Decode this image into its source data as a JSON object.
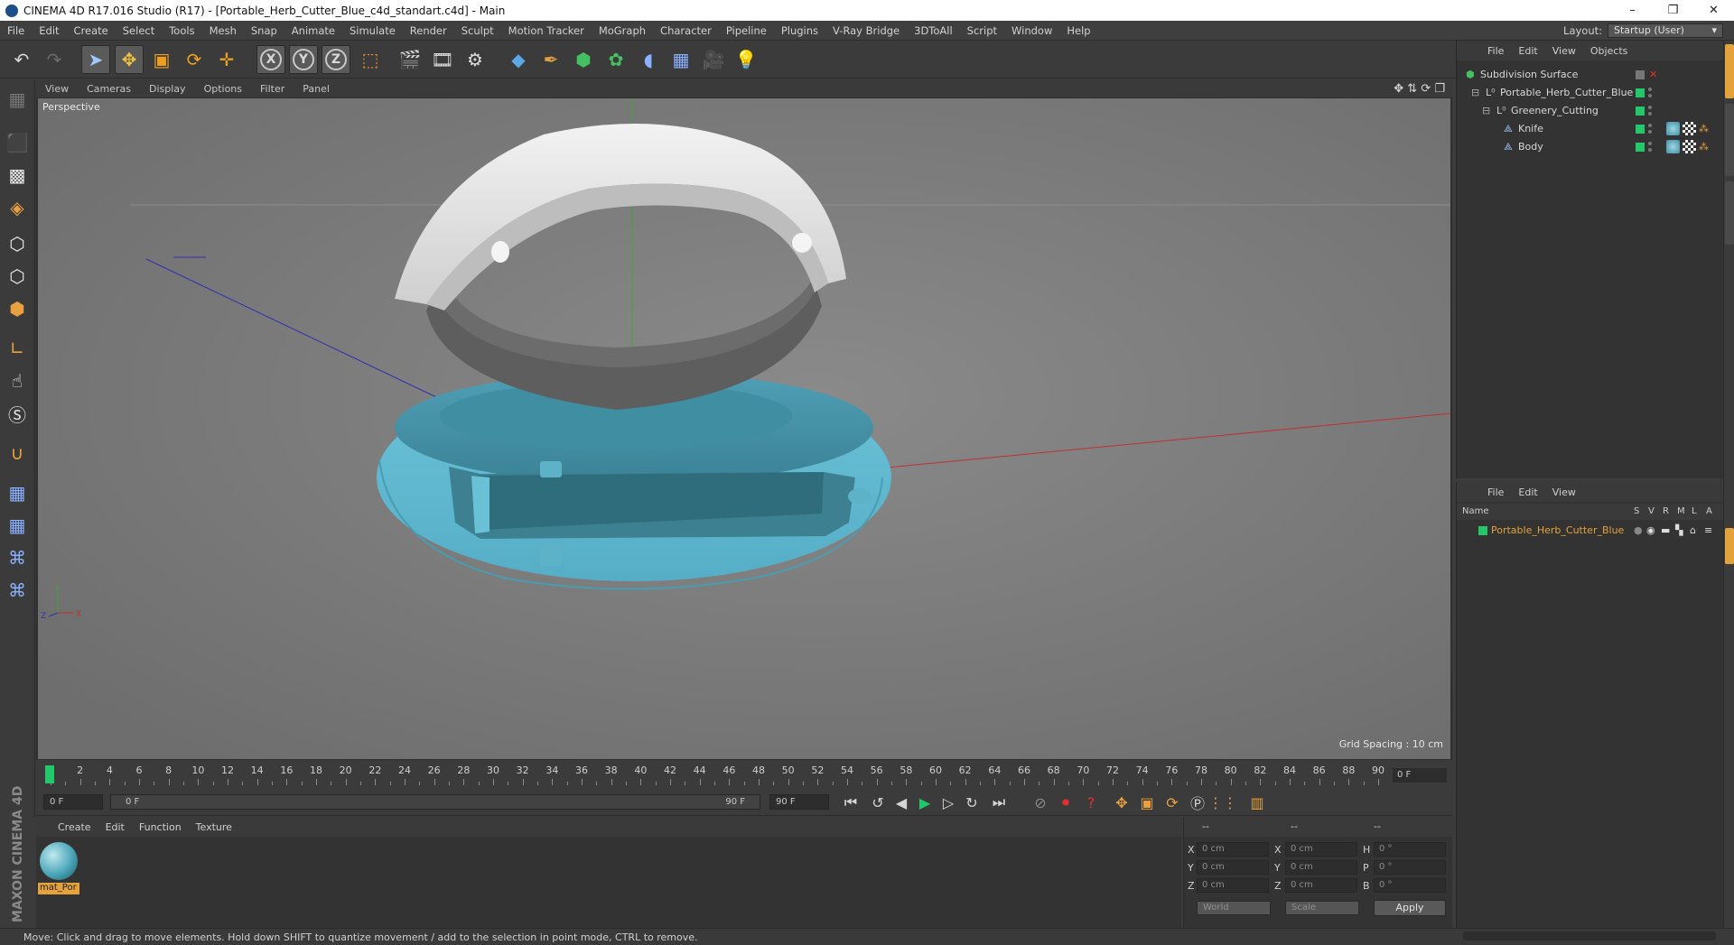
{
  "window": {
    "title": "CINEMA 4D R17.016 Studio (R17) - [Portable_Herb_Cutter_Blue_c4d_standart.c4d] - Main",
    "controls": [
      "–",
      "❐",
      "✕"
    ]
  },
  "menubar": {
    "items": [
      "File",
      "Edit",
      "Create",
      "Select",
      "Tools",
      "Mesh",
      "Snap",
      "Animate",
      "Simulate",
      "Render",
      "Sculpt",
      "Motion Tracker",
      "MoGraph",
      "Character",
      "Pipeline",
      "Plugins",
      "V-Ray Bridge",
      "3DToAll",
      "Script",
      "Window",
      "Help"
    ],
    "layout_label": "Layout:",
    "layout_value": "Startup (User)"
  },
  "toolbar": {
    "axis_x": "X",
    "axis_y": "Y",
    "axis_z": "Z",
    "icons": [
      "undo-icon",
      "redo-icon",
      "select-arrow-icon",
      "move-icon",
      "scale-icon",
      "rotate-icon",
      "live-select-icon",
      "axis-x-icon",
      "axis-y-icon",
      "axis-z-icon",
      "coordinate-system-icon",
      "render-view-icon",
      "render-picture-viewer-icon",
      "render-settings-icon",
      "cube-icon",
      "pen-spline-icon",
      "subdivision-icon",
      "cloner-icon",
      "deformer-icon",
      "floor-icon",
      "camera-icon",
      "light-icon"
    ]
  },
  "viewport": {
    "menu": [
      "View",
      "Cameras",
      "Display",
      "Options",
      "Filter",
      "Panel"
    ],
    "label": "Perspective",
    "grid_spacing": "Grid Spacing : 10 cm",
    "axis_labels": {
      "y": "Y",
      "z": "Z",
      "x": "X"
    }
  },
  "timeline": {
    "ticks": [
      "0",
      "2",
      "4",
      "6",
      "8",
      "10",
      "12",
      "14",
      "16",
      "18",
      "20",
      "22",
      "24",
      "26",
      "28",
      "30",
      "32",
      "34",
      "36",
      "38",
      "40",
      "42",
      "44",
      "46",
      "48",
      "50",
      "52",
      "54",
      "56",
      "58",
      "60",
      "62",
      "64",
      "66",
      "68",
      "70",
      "72",
      "74",
      "76",
      "78",
      "80",
      "82",
      "84",
      "86",
      "88",
      "90"
    ],
    "current_frame": "0 F"
  },
  "playback": {
    "start_field": "0 F",
    "range_start": "0 F",
    "range_end": "90 F",
    "end_field": "90 F"
  },
  "material_panel": {
    "menu": [
      "Create",
      "Edit",
      "Function",
      "Texture"
    ],
    "material_name": "mat_Por"
  },
  "coordinates": {
    "header": [
      "--",
      "--",
      "--"
    ],
    "rows": [
      {
        "label1": "X",
        "val1": "0 cm",
        "label2": "X",
        "val2": "0 cm",
        "label3": "H",
        "val3": "0 °"
      },
      {
        "label1": "Y",
        "val1": "0 cm",
        "label2": "Y",
        "val2": "0 cm",
        "label3": "P",
        "val3": "0 °"
      },
      {
        "label1": "Z",
        "val1": "0 cm",
        "label2": "Z",
        "val2": "0 cm",
        "label3": "B",
        "val3": "0 °"
      }
    ],
    "mode1": "World",
    "mode2": "Scale",
    "apply": "Apply"
  },
  "brand": "MAXON CINEMA 4D",
  "statusbar": {
    "text": "Move: Click and drag to move elements. Hold down SHIFT to quantize movement / add to the selection in point mode, CTRL to remove."
  },
  "object_manager": {
    "menu": [
      "File",
      "Edit",
      "View",
      "Objects"
    ],
    "objects": [
      {
        "name": "Subdivision Surface",
        "indent": 0
      },
      {
        "name": "Portable_Herb_Cutter_Blue",
        "indent": 1
      },
      {
        "name": "Greenery_Cutting",
        "indent": 2
      },
      {
        "name": "Knife",
        "indent": 3
      },
      {
        "name": "Body",
        "indent": 3
      }
    ]
  },
  "attribute_manager": {
    "menu": [
      "File",
      "Edit",
      "View"
    ],
    "columns": {
      "name": "Name",
      "s": "S",
      "v": "V",
      "r": "R",
      "m": "M",
      "l": "L",
      "a": "A"
    },
    "layer_row": "Portable_Herb_Cutter_Blue"
  },
  "colors": {
    "accent_green": "#22c86a",
    "selection_orange": "#e4a33a",
    "viewport_bg": "#7c7c7c",
    "model_blue": "#5fb6cc",
    "model_white": "#e4e4e4"
  }
}
